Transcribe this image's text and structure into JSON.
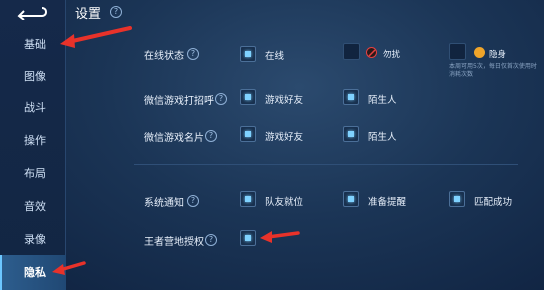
{
  "sidebar": {
    "items": [
      {
        "label": "基础"
      },
      {
        "label": "图像"
      },
      {
        "label": "战斗"
      },
      {
        "label": "操作"
      },
      {
        "label": "布局"
      },
      {
        "label": "音效"
      },
      {
        "label": "录像"
      },
      {
        "label": "隐私"
      }
    ],
    "active": "隐私"
  },
  "header": {
    "title": "设置"
  },
  "online_status": {
    "label": "在线状态",
    "options": [
      {
        "label": "在线",
        "checked": true
      },
      {
        "label": "勿扰",
        "checked": false
      },
      {
        "label": "隐身",
        "checked": false
      }
    ],
    "note": "本周可用5次，每日仅首次使用时消耗次数"
  },
  "wechat_greeting": {
    "label": "微信游戏打招呼",
    "options": [
      {
        "label": "游戏好友",
        "checked": true
      },
      {
        "label": "陌生人",
        "checked": true
      }
    ]
  },
  "wechat_card": {
    "label": "微信游戏名片",
    "options": [
      {
        "label": "游戏好友",
        "checked": true
      },
      {
        "label": "陌生人",
        "checked": true
      }
    ]
  },
  "system_notice": {
    "label": "系统通知",
    "options": [
      {
        "label": "队友就位",
        "checked": true
      },
      {
        "label": "准备提醒",
        "checked": true
      },
      {
        "label": "匹配成功",
        "checked": true
      }
    ]
  },
  "camp_auth": {
    "label": "王者营地授权",
    "checked": true
  },
  "colors": {
    "accent": "#7fd2ff",
    "annotation": "#e8322a",
    "dnd": "#e64040",
    "invisible": "#f0a52a"
  }
}
